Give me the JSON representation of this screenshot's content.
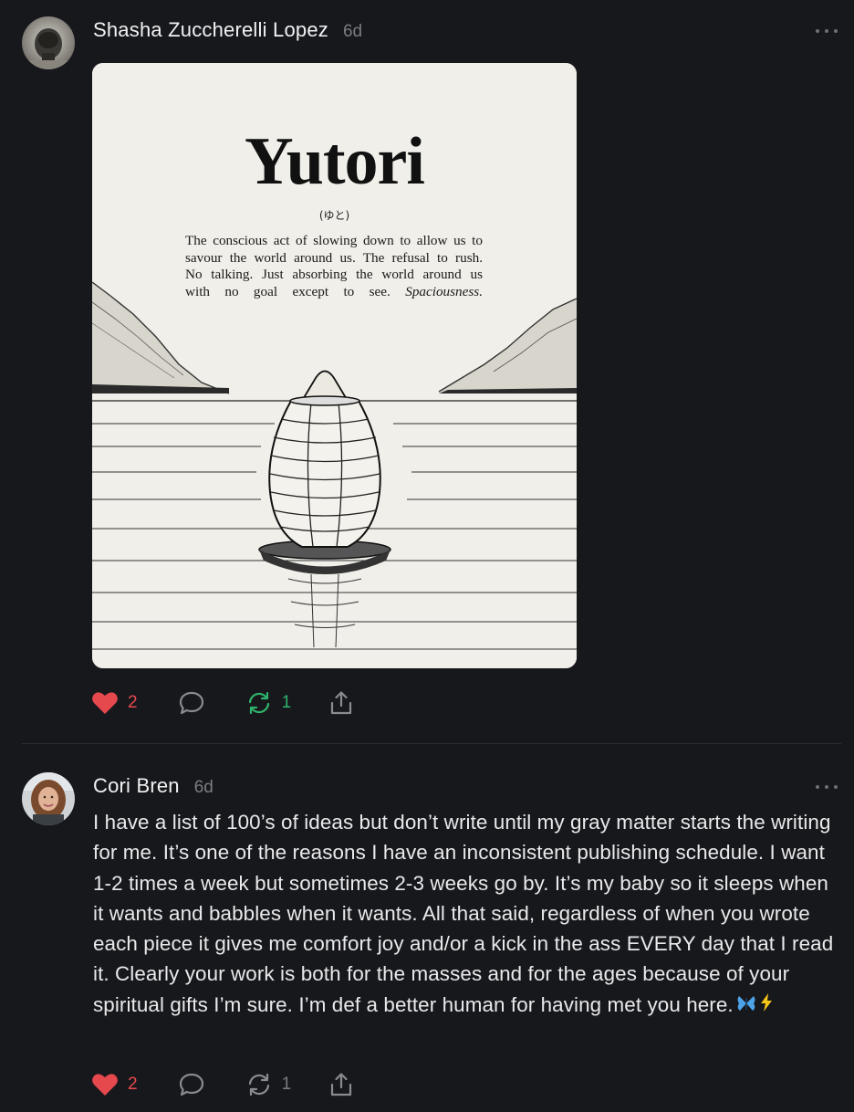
{
  "posts": [
    {
      "author": "Shasha Zuccherelli Lopez",
      "time": "6d",
      "image": {
        "title": "Yutori",
        "kana": "(ゆと)",
        "definition_lines": [
          "The conscious act of slowing down to allow us to",
          "savour the world around us. The refusal to rush.",
          "No talking. Just absorbing the world around us",
          "with no goal except to see."
        ],
        "definition_emphasis": "Spaciousness."
      },
      "actions": {
        "likes": "2",
        "restacks": "1"
      }
    },
    {
      "author": "Cori Bren",
      "time": "6d",
      "body": "I have a list of 100’s of ideas but don’t write until my gray matter starts the writing for me. It’s one of the reasons I have an inconsistent publishing schedule. I want 1-2 times a week but sometimes 2-3 weeks go by. It’s my baby so it sleeps when it wants and babbles when it wants. All that said, regardless of when you wrote each piece it gives me comfort joy and/or a kick in the ass EVERY day that I read it. Clearly your work is both for the masses and for the ages because of your spiritual gifts I’m sure. I’m def a better human for having met you here.",
      "actions": {
        "likes": "2",
        "restacks": "1"
      }
    }
  ],
  "colors": {
    "background": "#17181c",
    "like": "#e5484d",
    "restack_active": "#2fb26b",
    "muted": "#7b7c82"
  },
  "icons": {
    "like": "heart-icon",
    "comment": "speech-bubble-icon",
    "restack": "restack-arrows-icon",
    "share": "share-upload-icon",
    "more": "ellipsis-icon",
    "emoji": [
      "butterfly-emoji",
      "lightning-emoji"
    ]
  }
}
